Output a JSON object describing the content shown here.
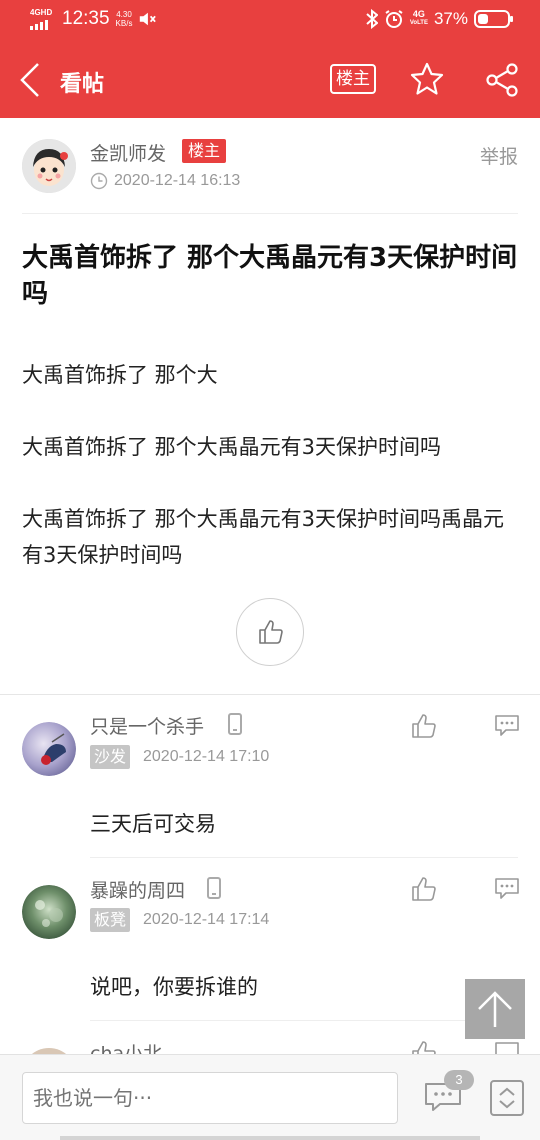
{
  "status_bar": {
    "network": "4GHD",
    "time": "12:35",
    "speed_value": "4.30",
    "speed_unit": "KB/s",
    "cell_label_top": "4G",
    "cell_label_bottom": "VoLTE",
    "battery_percent": "37%",
    "battery_level": 0.37
  },
  "nav": {
    "title": "看帖",
    "owner_only_label": "楼主"
  },
  "post": {
    "author": "金凯师发",
    "author_badge": "楼主",
    "report_label": "举报",
    "time": "2020-12-14 16:13",
    "title": "大禹首饰拆了 那个大禹晶元有3天保护时间吗",
    "paragraphs": [
      "大禹首饰拆了 那个大",
      "大禹首饰拆了 那个大禹晶元有3天保护时间吗",
      "大禹首饰拆了 那个大禹晶元有3天保护时间吗禹晶元有3天保护时间吗"
    ]
  },
  "comments": [
    {
      "name": "只是一个杀手",
      "floor": "沙发",
      "time": "2020-12-14 17:10",
      "content": "三天后可交易"
    },
    {
      "name": "暴躁的周四",
      "floor": "板凳",
      "time": "2020-12-14 17:14",
      "content": "说吧，你要拆谁的"
    },
    {
      "name": "cha小北"
    }
  ],
  "bottom_bar": {
    "input_placeholder": "我也说一句···",
    "comment_count": "3"
  },
  "colors": {
    "brand_red": "#e8403f",
    "text_gray": "#666666",
    "meta_gray": "#999999"
  }
}
